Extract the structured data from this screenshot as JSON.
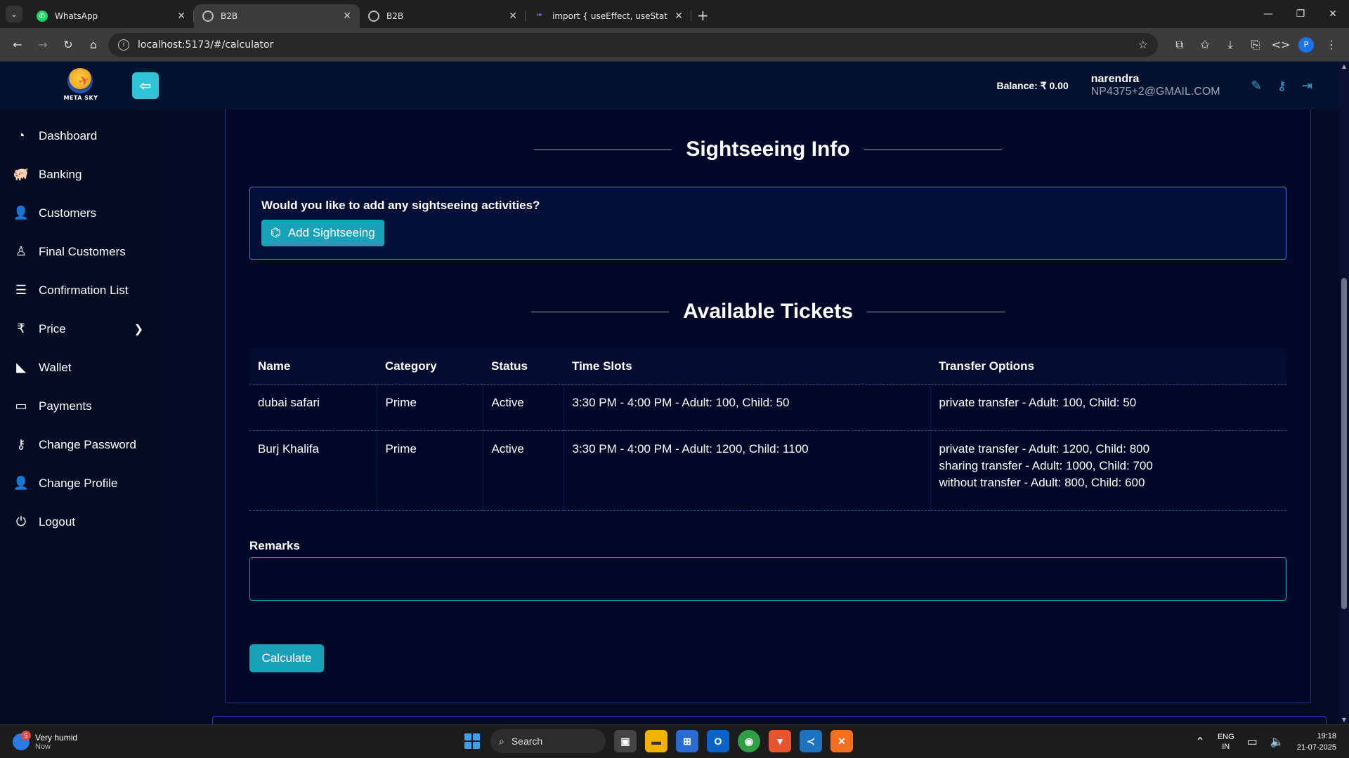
{
  "browser": {
    "tabs": [
      {
        "title": "WhatsApp",
        "favicon": "whatsapp-icon",
        "active": false
      },
      {
        "title": "B2B",
        "favicon": "globe-icon",
        "active": true
      },
      {
        "title": "B2B",
        "favicon": "globe-icon",
        "active": false
      },
      {
        "title": "import { useEffect, useState, us",
        "favicon": "code-icon",
        "active": false
      }
    ],
    "url": "localhost:5173/#/calculator",
    "profile_initial": "P"
  },
  "header": {
    "logo_text": "META SKY",
    "balance": "Balance: ₹ 0.00",
    "user_name": "narendra",
    "user_email": "NP4375+2@GMAIL.COM"
  },
  "sidebar": {
    "items": [
      {
        "label": "Dashboard",
        "icon": "dashboard-icon"
      },
      {
        "label": "Banking",
        "icon": "piggy-bank-icon"
      },
      {
        "label": "Customers",
        "icon": "user-icon"
      },
      {
        "label": "Final Customers",
        "icon": "user-outline-icon"
      },
      {
        "label": "Confirmation List",
        "icon": "list-icon"
      },
      {
        "label": "Price",
        "icon": "rupee-icon"
      },
      {
        "label": "Wallet",
        "icon": "wallet-icon"
      },
      {
        "label": "Payments",
        "icon": "credit-card-icon"
      },
      {
        "label": "Change Password",
        "icon": "key-icon"
      },
      {
        "label": "Change Profile",
        "icon": "user-edit-icon"
      },
      {
        "label": "Logout",
        "icon": "power-icon"
      }
    ]
  },
  "sightseeing": {
    "title": "Sightseeing Info",
    "question": "Would you like to add any sightseeing activities?",
    "add_button": "Add Sightseeing"
  },
  "tickets": {
    "title": "Available Tickets",
    "columns": [
      "Name",
      "Category",
      "Status",
      "Time Slots",
      "Transfer Options"
    ],
    "rows": [
      {
        "name": "dubai safari",
        "category": "Prime",
        "status": "Active",
        "time_slots": "3:30 PM - 4:00 PM - Adult: 100, Child: 50",
        "transfers": [
          "private transfer - Adult: 100, Child: 50"
        ]
      },
      {
        "name": "Burj Khalifa",
        "category": "Prime",
        "status": "Active",
        "time_slots": "3:30 PM - 4:00 PM - Adult: 1200, Child: 1100",
        "transfers": [
          "private transfer - Adult: 1200, Child: 800",
          "sharing transfer - Adult: 1000, Child: 700",
          "without transfer - Adult: 800, Child: 600"
        ]
      }
    ]
  },
  "remarks": {
    "label": "Remarks",
    "value": ""
  },
  "calculate_button": "Calculate",
  "taskbar": {
    "weather_title": "Very humid",
    "weather_sub": "Now",
    "weather_badge": "5",
    "search_label": "Search",
    "lang_line1": "ENG",
    "lang_line2": "IN",
    "time": "19:18",
    "date": "21-07-2025"
  },
  "colors": {
    "accent": "#17a2b8",
    "header_bg": "#03122e",
    "page_bg": "#050a24"
  }
}
